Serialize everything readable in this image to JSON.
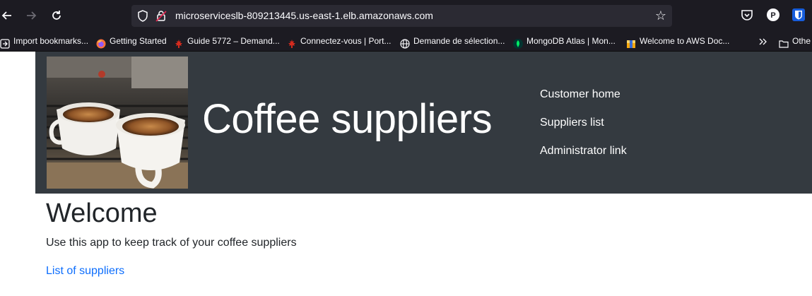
{
  "browser": {
    "url": "microserviceslb-809213445.us-east-1.elb.amazonaws.com",
    "bookmarks": [
      {
        "label": "Import bookmarks...",
        "icon": "import-icon"
      },
      {
        "label": "Getting Started",
        "icon": "firefox-icon"
      },
      {
        "label": "Guide 5772 – Demand...",
        "icon": "maple-leaf-icon"
      },
      {
        "label": "Connectez-vous | Port...",
        "icon": "maple-leaf-icon"
      },
      {
        "label": "Demande de sélection...",
        "icon": "globe-icon"
      },
      {
        "label": "MongoDB Atlas | Mon...",
        "icon": "mongodb-leaf-icon"
      },
      {
        "label": "Welcome to AWS Doc...",
        "icon": "aws-icon"
      }
    ],
    "other_bookmarks": "Othe"
  },
  "header": {
    "title": "Coffee suppliers",
    "nav": [
      "Customer home",
      "Suppliers list",
      "Administrator link"
    ]
  },
  "main": {
    "heading": "Welcome",
    "lead": "Use this app to keep track of your coffee suppliers",
    "link": "List of suppliers"
  },
  "colors": {
    "header_bg": "#343a40",
    "link": "#0d6efd",
    "chrome_bg": "#1c1b22"
  }
}
